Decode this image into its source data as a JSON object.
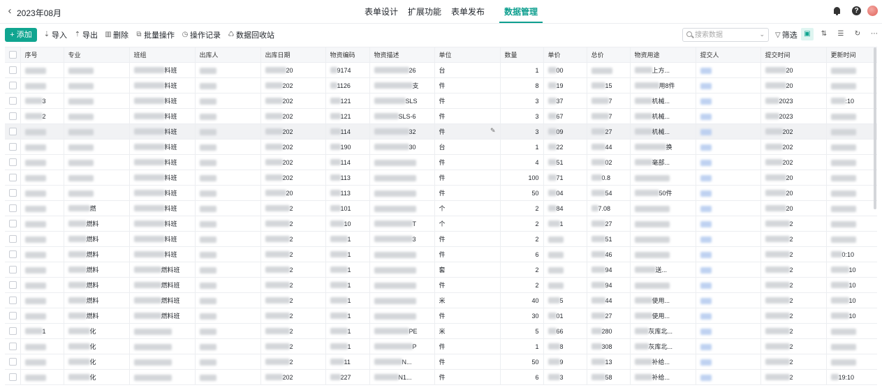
{
  "header": {
    "title": "2023年08月",
    "tabs": [
      {
        "label": "表单设计"
      },
      {
        "label": "扩展功能"
      },
      {
        "label": "表单发布"
      },
      {
        "label": "数据管理"
      }
    ],
    "active_tab": "数据管理"
  },
  "toolbar": {
    "add_label": "添加",
    "actions": [
      {
        "label": "导入",
        "icon": "import-icon"
      },
      {
        "label": "导出",
        "icon": "export-icon"
      },
      {
        "label": "删除",
        "icon": "trash-icon"
      },
      {
        "label": "批量操作",
        "icon": "batch-icon"
      },
      {
        "label": "操作记录",
        "icon": "history-icon"
      },
      {
        "label": "数据回收站",
        "icon": "recycle-icon"
      }
    ],
    "search_placeholder": "搜索数据",
    "filter_label": "筛选"
  },
  "colors": {
    "accent": "#10a590",
    "row_hover": "#f1f2f4"
  },
  "table": {
    "columns": [
      "序号",
      "专业",
      "班组",
      "出库人",
      "出库日期",
      "物资编码",
      "物资描述",
      "单位",
      "数量",
      "单价",
      "总价",
      "物资用途",
      "提交人",
      "提交时间",
      "更新时间"
    ],
    "rows": [
      {
        "c1": "",
        "c2": "",
        "c3": "料班",
        "c4": "",
        "c5": "20",
        "c6": "9174",
        "c7": "26",
        "unit": "台",
        "qty": "1",
        "price": "00",
        "total": "",
        "use": "上方...",
        "c13": "",
        "c14": "20",
        "c15": ""
      },
      {
        "c1": "",
        "c2": "",
        "c3": "料班",
        "c4": "",
        "c5": "202",
        "c6": "1126",
        "c7": "支",
        "unit": "件",
        "qty": "8",
        "price": "19",
        "total": "15",
        "use": "用8件",
        "c13": "",
        "c14": "20",
        "c15": ""
      },
      {
        "c1": "3",
        "c2": "",
        "c3": "料班",
        "c4": "",
        "c5": "202",
        "c6": "121",
        "c7": "SLS",
        "unit": "件",
        "qty": "3",
        "price": "37",
        "total": "7",
        "use": "机械...",
        "c13": "",
        "c14": "2023",
        "c15": ":10"
      },
      {
        "c1": "2",
        "c2": "",
        "c3": "料班",
        "c4": "",
        "c5": "202",
        "c6": "121",
        "c7": "SLS-6",
        "unit": "件",
        "qty": "3",
        "price": "67",
        "total": "7",
        "use": "机械...",
        "c13": "",
        "c14": "2023",
        "c15": ""
      },
      {
        "c1": "",
        "c2": "",
        "c3": "料班",
        "c4": "",
        "c5": "202",
        "c6": "114",
        "c7": "32",
        "unit": "件",
        "qty": "3",
        "price": "09",
        "total": "27",
        "use": "机械...",
        "c13": "",
        "c14": "202",
        "c15": ""
      },
      {
        "c1": "",
        "c2": "",
        "c3": "料班",
        "c4": "",
        "c5": "202",
        "c6": "190",
        "c7": "30",
        "unit": "台",
        "qty": "1",
        "price": "22",
        "total": "44",
        "use": "换",
        "c13": "",
        "c14": "202",
        "c15": ""
      },
      {
        "c1": "",
        "c2": "",
        "c3": "料班",
        "c4": "",
        "c5": "202",
        "c6": "114",
        "c7": "",
        "unit": "件",
        "qty": "4",
        "price": "51",
        "total": "02",
        "use": "毫部...",
        "c13": "",
        "c14": "202",
        "c15": ""
      },
      {
        "c1": "",
        "c2": "",
        "c3": "料班",
        "c4": "",
        "c5": "202",
        "c6": "113",
        "c7": "",
        "unit": "件",
        "qty": "100",
        "price": "71",
        "total": "0.8",
        "use": "",
        "c13": "",
        "c14": "20",
        "c15": ""
      },
      {
        "c1": "",
        "c2": "",
        "c3": "料班",
        "c4": "",
        "c5": "20",
        "c6": "113",
        "c7": "",
        "unit": "件",
        "qty": "50",
        "price": "04",
        "total": "54",
        "use": "50件",
        "c13": "",
        "c14": "20",
        "c15": ""
      },
      {
        "c1": "",
        "c2": "燃",
        "c3": "料班",
        "c4": "",
        "c5": "2",
        "c6": "101",
        "c7": "",
        "unit": "个",
        "qty": "2",
        "price": "84",
        "total": "7.08",
        "use": "",
        "c13": "",
        "c14": "20",
        "c15": ""
      },
      {
        "c1": "",
        "c2": "燃料",
        "c3": "料班",
        "c4": "",
        "c5": "2",
        "c6": "10",
        "c7": "T",
        "unit": "个",
        "qty": "2",
        "price": "1",
        "total": "27",
        "use": "",
        "c13": "",
        "c14": "2",
        "c15": ""
      },
      {
        "c1": "",
        "c2": "燃料",
        "c3": "料班",
        "c4": "",
        "c5": "2",
        "c6": "1",
        "c7": "3",
        "unit": "件",
        "qty": "2",
        "price": "",
        "total": "51",
        "use": "",
        "c13": "",
        "c14": "2",
        "c15": ""
      },
      {
        "c1": "",
        "c2": "燃料",
        "c3": "料班",
        "c4": "",
        "c5": "2",
        "c6": "1",
        "c7": "",
        "unit": "件",
        "qty": "6",
        "price": "",
        "total": "46",
        "use": "",
        "c13": "",
        "c14": "2",
        "c15": "0:10"
      },
      {
        "c1": "",
        "c2": "燃料",
        "c3": "燃料班",
        "c4": "",
        "c5": "2",
        "c6": "1",
        "c7": "",
        "unit": "套",
        "qty": "2",
        "price": "",
        "total": "94",
        "use": "送...",
        "c13": "",
        "c14": "2",
        "c15": "10"
      },
      {
        "c1": "",
        "c2": "燃料",
        "c3": "燃料班",
        "c4": "",
        "c5": "2",
        "c6": "1",
        "c7": "",
        "unit": "件",
        "qty": "2",
        "price": "",
        "total": "94",
        "use": "",
        "c13": "",
        "c14": "2",
        "c15": "10"
      },
      {
        "c1": "",
        "c2": "燃料",
        "c3": "燃料班",
        "c4": "",
        "c5": "2",
        "c6": "1",
        "c7": "",
        "unit": "米",
        "qty": "40",
        "price": "5",
        "total": "44",
        "use": "使用...",
        "c13": "",
        "c14": "2",
        "c15": "10"
      },
      {
        "c1": "",
        "c2": "燃料",
        "c3": "燃料班",
        "c4": "",
        "c5": "2",
        "c6": "1",
        "c7": "",
        "unit": "件",
        "qty": "30",
        "price": "01",
        "total": "27",
        "use": "使用...",
        "c13": "",
        "c14": "2",
        "c15": "10"
      },
      {
        "c1": "1",
        "c2": "化",
        "c3": "",
        "c4": "",
        "c5": "2",
        "c6": "1",
        "c7": "PE",
        "unit": "米",
        "qty": "5",
        "price": "66",
        "total": "280",
        "use": "灰库北...",
        "c13": "",
        "c14": "2",
        "c15": ""
      },
      {
        "c1": "",
        "c2": "化",
        "c3": "",
        "c4": "",
        "c5": "2",
        "c6": "1",
        "c7": "P",
        "unit": "件",
        "qty": "1",
        "price": "8",
        "total": "308",
        "use": "灰库北...",
        "c13": "",
        "c14": "2",
        "c15": ""
      },
      {
        "c1": "",
        "c2": "化",
        "c3": "",
        "c4": "",
        "c5": "2",
        "c6": "11",
        "c7": "N...",
        "unit": "件",
        "qty": "50",
        "price": "9",
        "total": "13",
        "use": "补给...",
        "c13": "",
        "c14": "2",
        "c15": ""
      },
      {
        "c1": "",
        "c2": "化",
        "c3": "",
        "c4": "",
        "c5": "202",
        "c6": "227",
        "c7": "N1...",
        "unit": "件",
        "qty": "6",
        "price": "3",
        "total": "58",
        "use": "补给...",
        "c13": "",
        "c14": "2",
        "c15": "19:10"
      }
    ]
  }
}
